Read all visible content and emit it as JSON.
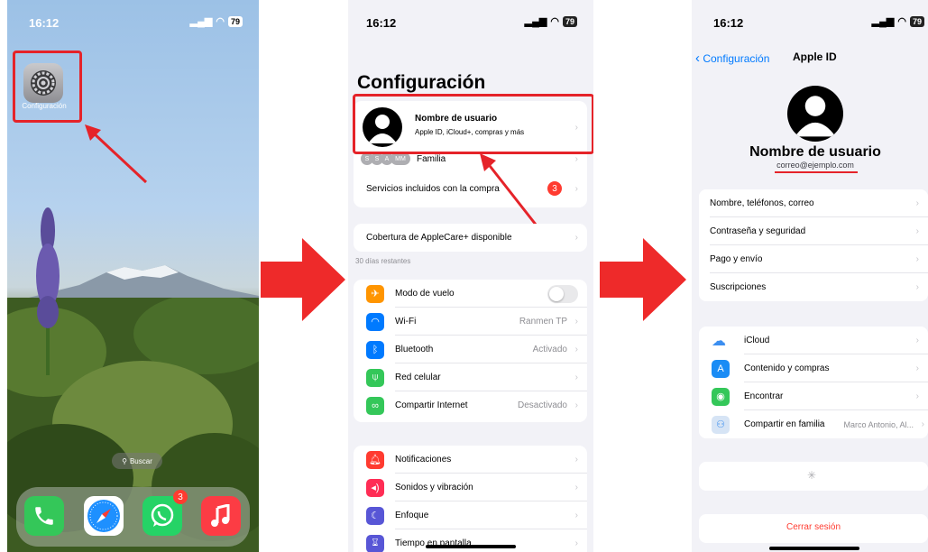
{
  "status": {
    "time": "16:12",
    "battery": "79"
  },
  "home": {
    "settings_app_label": "Configuración",
    "search_label": "Buscar",
    "whatsapp_badge": "3"
  },
  "settings": {
    "title": "Configuración",
    "profile_name": "Nombre de usuario",
    "profile_subtitle": "Apple ID, iCloud+, compras y más",
    "family_avatars": [
      "S",
      "S",
      "A",
      "MM"
    ],
    "family_label": "Familia",
    "services_label": "Servicios incluidos con la compra",
    "services_badge": "3",
    "applecare_label": "Cobertura de AppleCare+ disponible",
    "applecare_note": "30 días restantes",
    "rows": [
      {
        "label": "Modo de vuelo",
        "value": ""
      },
      {
        "label": "Wi-Fi",
        "value": "Ranmen TP"
      },
      {
        "label": "Bluetooth",
        "value": "Activado"
      },
      {
        "label": "Red celular",
        "value": ""
      },
      {
        "label": "Compartir Internet",
        "value": "Desactivado"
      }
    ],
    "rows2": [
      {
        "label": "Notificaciones"
      },
      {
        "label": "Sonidos y vibración"
      },
      {
        "label": "Enfoque"
      },
      {
        "label": "Tiempo en pantalla"
      }
    ]
  },
  "appleid": {
    "back_label": "Configuración",
    "title": "Apple ID",
    "name": "Nombre de usuario",
    "email": "correo@ejemplo.com",
    "account_rows": [
      {
        "label": "Nombre, teléfonos, correo"
      },
      {
        "label": "Contraseña y seguridad"
      },
      {
        "label": "Pago y envío"
      },
      {
        "label": "Suscripciones"
      }
    ],
    "service_rows": [
      {
        "label": "iCloud",
        "value": ""
      },
      {
        "label": "Contenido y compras",
        "value": ""
      },
      {
        "label": "Encontrar",
        "value": ""
      },
      {
        "label": "Compartir en familia",
        "value": "Marco Antonio, Al..."
      }
    ],
    "signout_label": "Cerrar sesión"
  },
  "colors": {
    "annotation_red": "#e52329",
    "ios_blue": "#007aff",
    "ios_red": "#ff3b30"
  }
}
